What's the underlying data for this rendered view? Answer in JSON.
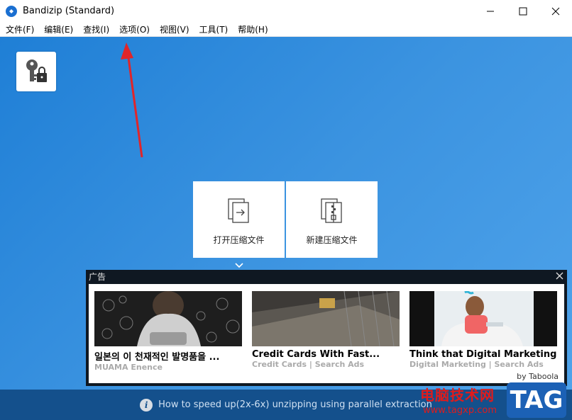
{
  "window": {
    "title": "Bandizip (Standard)"
  },
  "menu": [
    {
      "label": "文件(F)"
    },
    {
      "label": "编辑(E)"
    },
    {
      "label": "查找(I)"
    },
    {
      "label": "选项(O)"
    },
    {
      "label": "视图(V)"
    },
    {
      "label": "工具(T)"
    },
    {
      "label": "帮助(H)"
    }
  ],
  "main": {
    "tiles": [
      {
        "label": "打开压缩文件",
        "icon": "open-archive-icon"
      },
      {
        "label": "新建压缩文件",
        "icon": "new-archive-icon"
      }
    ]
  },
  "ad": {
    "header": "广告",
    "cards": [
      {
        "headline": "일본의 이 천재적인 발명품을 ...",
        "source": "MUAMA Enence"
      },
      {
        "headline": "Credit Cards With Fast...",
        "source": "Credit Cards | Search Ads"
      },
      {
        "headline": "Think that Digital Marketing...",
        "source": "Digital Marketing | Search Ads"
      }
    ],
    "attribution": "by Taboola"
  },
  "status": {
    "text": "How to speed up(2x-6x) unzipping using parallel extraction"
  },
  "watermark": {
    "line1": "电脑技术网",
    "line2": "www.tagxp.com",
    "tag": "TAG"
  },
  "colors": {
    "accent": "#1f7fd6",
    "statusbar": "#14508c",
    "ad_panel": "#0f1822",
    "annotation_arrow": "#e0252a"
  }
}
